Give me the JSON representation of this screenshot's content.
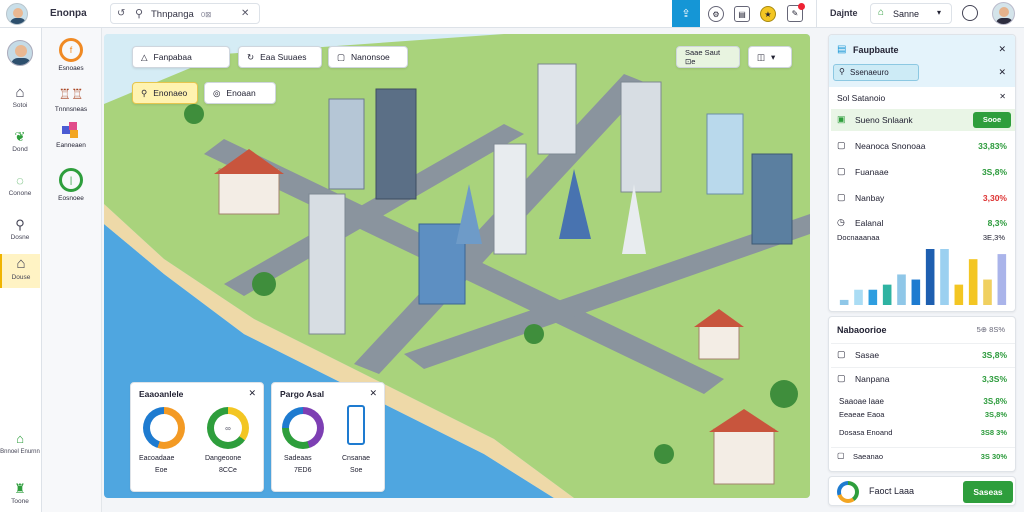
{
  "topbar": {
    "app_title": "Enonpa",
    "search_value": "Thnpanga",
    "search_hint": "0⊠",
    "right_label": "Dajnte",
    "tab_label": "Sanne"
  },
  "sidebar": {
    "items": [
      {
        "label": "Sotoi",
        "icon": "house-icon"
      },
      {
        "label": "Dond",
        "icon": "leaf-icon"
      },
      {
        "label": "Conone",
        "icon": "pin-icon"
      },
      {
        "label": "Dosne",
        "icon": "search-pin-icon"
      },
      {
        "label": "Douse",
        "icon": "house-active-icon"
      },
      {
        "label": "Bnnoel Enurnn",
        "icon": "building-icon"
      },
      {
        "label": "Toone",
        "icon": "tower-icon"
      }
    ]
  },
  "leftpanel": {
    "items": [
      {
        "label": "Esnoaes",
        "icon": "compass-icon"
      },
      {
        "label": "Tnnnsneas",
        "icon": "factory-icon"
      },
      {
        "label": "Eanneaen",
        "icon": "blocks-icon"
      },
      {
        "label": "Eosnoee",
        "icon": "ring-icon"
      }
    ]
  },
  "map": {
    "tool_1": "Fanpabaa",
    "tool_2": "Eaa Suuaes",
    "tool_3": "Nanonsoe",
    "tool_4": "Enonaeo",
    "tool_5": "Enoaan",
    "top_right_label": "Saae Saut ⊡e",
    "stats_card_1": {
      "title": "Eaaoanlele",
      "items": [
        {
          "label": "Eacoadaae",
          "value": "Eoe"
        },
        {
          "label": "Dangeoone",
          "value": "8CCe"
        }
      ]
    },
    "stats_card_2": {
      "title": "Pargo Asal",
      "items": [
        {
          "label": "Sadeaas",
          "value": "7ED6"
        },
        {
          "label": "Cnsanae",
          "value": "Soe"
        }
      ]
    }
  },
  "right": {
    "panel_title": "Faupbaute",
    "search_value": "Ssenaeuro",
    "section_label": "Sol Satanoio",
    "rows": [
      {
        "label": "Sueno Snlaank",
        "value": "Sooe",
        "type": "button"
      },
      {
        "label": "Neanoca Snonoaa",
        "value": "33,83%",
        "type": "pos"
      },
      {
        "label": "Fuanaae",
        "value": "3S,8%",
        "type": "pos"
      },
      {
        "label": "Nanbay",
        "value": "3,30%",
        "type": "neg"
      },
      {
        "label": "Ealanal",
        "value": "8,3%",
        "type": "pos"
      }
    ],
    "chart_label": "Docnaaanaa",
    "chart_value": "3E,3%",
    "chart_data": {
      "type": "bar",
      "values": [
        1,
        3,
        3,
        4,
        6,
        5,
        11,
        11,
        4,
        9,
        5,
        10
      ]
    },
    "section2_title": "Nabaoorioe",
    "section2_value": "5⊕ 8S%",
    "rows2": [
      {
        "label": "Sasae",
        "value": "3S,8%"
      },
      {
        "label": "Nanpana",
        "value": "3,3S%"
      }
    ],
    "rows3": [
      {
        "label": "Saaoae laae",
        "value": "3S,8%"
      },
      {
        "label": "Eeaeae Eaoa",
        "value": "3S,8%"
      },
      {
        "label": "Dosasa Enoand",
        "value": "3S8 3%"
      },
      {
        "label": "Saeanao",
        "value": "3S 30%"
      }
    ],
    "footer_label": "Faoct Laaa",
    "footer_button": "Saseas"
  },
  "colors": {
    "accent": "#1596d6",
    "green": "#2e9e3c",
    "active": "#fff3c4"
  }
}
